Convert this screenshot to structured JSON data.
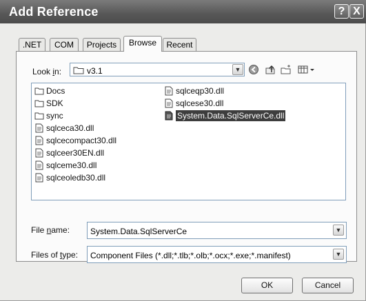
{
  "window": {
    "title": "Add Reference"
  },
  "tabs": [
    {
      "label": ".NET"
    },
    {
      "label": "COM"
    },
    {
      "label": "Projects"
    },
    {
      "label": "Browse"
    },
    {
      "label": "Recent"
    }
  ],
  "look_in": {
    "label_pre": "Look ",
    "label_key": "i",
    "label_post": "n:",
    "value": "v3.1"
  },
  "files": [
    {
      "name": "Docs",
      "type": "folder"
    },
    {
      "name": "SDK",
      "type": "folder"
    },
    {
      "name": "sync",
      "type": "folder"
    },
    {
      "name": "sqlceca30.dll",
      "type": "dll"
    },
    {
      "name": "sqlcecompact30.dll",
      "type": "dll"
    },
    {
      "name": "sqlceer30EN.dll",
      "type": "dll"
    },
    {
      "name": "sqlceme30.dll",
      "type": "dll"
    },
    {
      "name": "sqlceoledb30.dll",
      "type": "dll"
    },
    {
      "name": "sqlceqp30.dll",
      "type": "dll"
    },
    {
      "name": "sqlcese30.dll",
      "type": "dll"
    },
    {
      "name": "System.Data.SqlServerCe.dll",
      "type": "dll",
      "selected": true
    }
  ],
  "file_name": {
    "label_pre": "File ",
    "label_key": "n",
    "label_post": "ame:",
    "value": "System.Data.SqlServerCe"
  },
  "files_of_type": {
    "label_pre": "Files of ",
    "label_key": "t",
    "label_post": "ype:",
    "value": "Component Files (*.dll;*.tlb;*.olb;*.ocx;*.exe;*.manifest)"
  },
  "buttons": {
    "ok": "OK",
    "cancel": "Cancel",
    "help": "?",
    "close": "X"
  }
}
